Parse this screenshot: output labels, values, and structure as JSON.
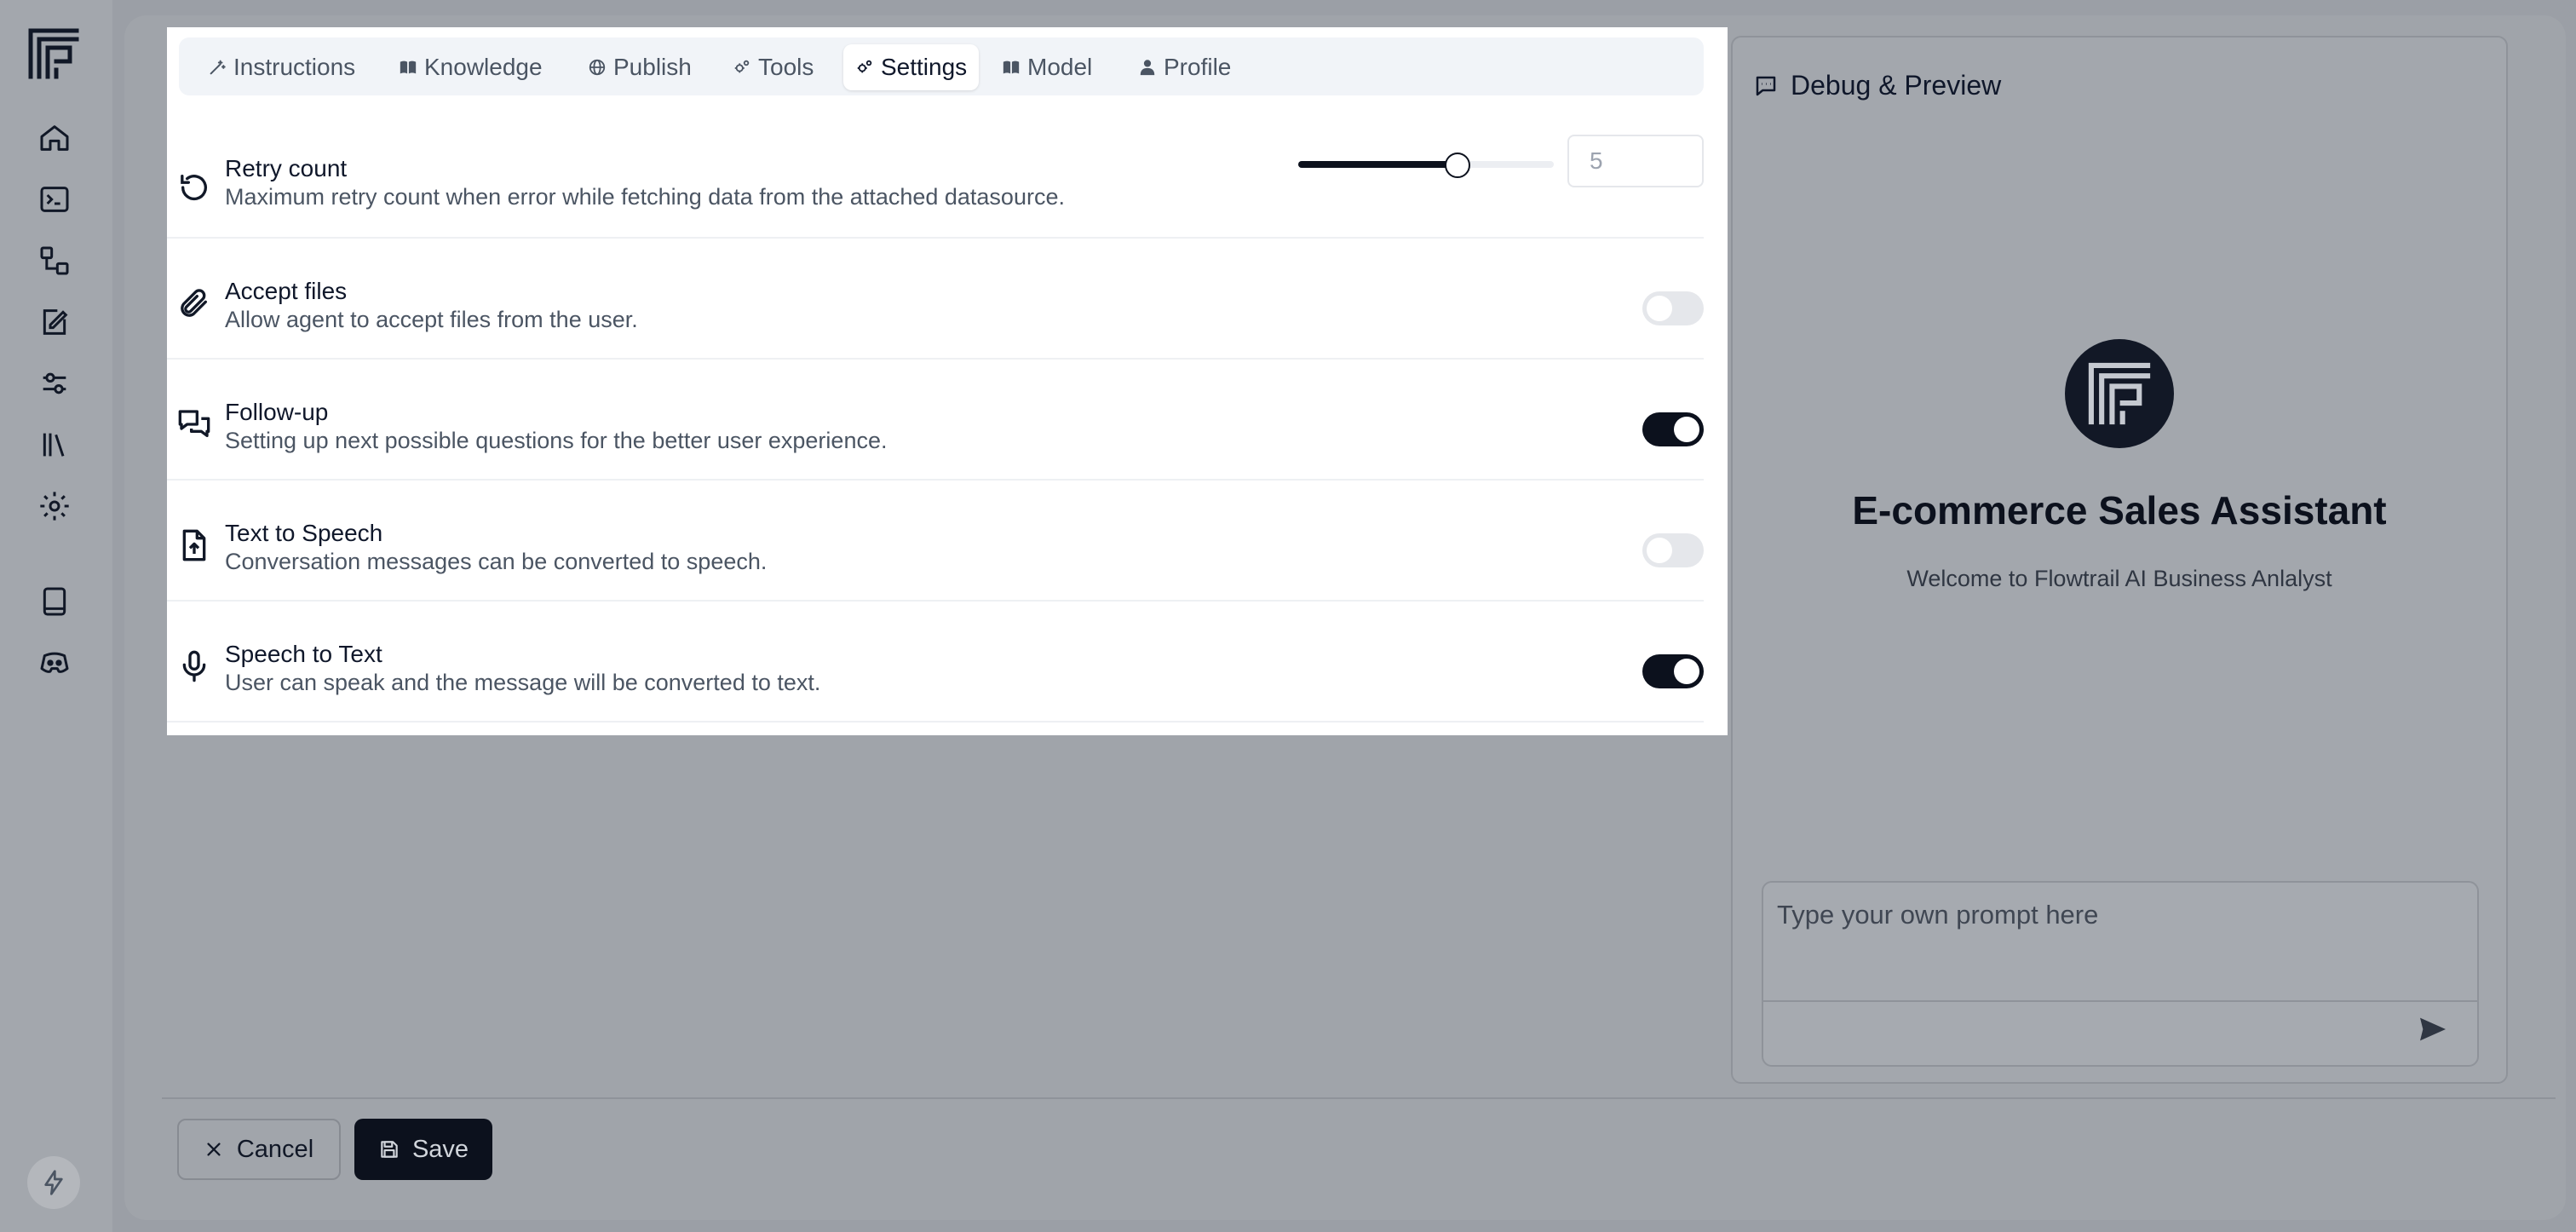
{
  "app": {
    "sidebar": {
      "items": [
        {
          "icon": "home-icon"
        },
        {
          "icon": "terminal-icon"
        },
        {
          "icon": "workflow-icon"
        },
        {
          "icon": "document-edit-icon"
        },
        {
          "icon": "sliders-icon"
        },
        {
          "icon": "library-icon"
        },
        {
          "icon": "gear-icon"
        },
        {
          "icon": "book-icon"
        },
        {
          "icon": "discord-icon"
        }
      ],
      "bottom_icon": "bolt-icon"
    }
  },
  "tabs": [
    {
      "label": "Instructions",
      "icon": "wand-icon",
      "active": false
    },
    {
      "label": "Knowledge",
      "icon": "book-open-icon",
      "active": false
    },
    {
      "label": "Publish",
      "icon": "globe-icon",
      "active": false
    },
    {
      "label": "Tools",
      "icon": "cogs-icon",
      "active": false
    },
    {
      "label": "Settings",
      "icon": "cogs-icon",
      "active": true
    },
    {
      "label": "Model",
      "icon": "book-open-icon",
      "active": false
    },
    {
      "label": "Profile",
      "icon": "user-icon",
      "active": false
    }
  ],
  "settings": {
    "retry": {
      "title": "Retry count",
      "description": "Maximum retry count when error while fetching data from the attached datasource.",
      "value": "5",
      "slider_fraction": 0.62
    },
    "accept_files": {
      "title": "Accept files",
      "description": "Allow agent to accept files from the user.",
      "enabled": false
    },
    "follow_up": {
      "title": "Follow-up",
      "description": "Setting up next possible questions for the better user experience.",
      "enabled": true
    },
    "tts": {
      "title": "Text to Speech",
      "description": "Conversation messages can be converted to speech.",
      "enabled": false
    },
    "stt": {
      "title": "Speech to Text",
      "description": "User can speak and the message will be converted to text.",
      "enabled": true
    }
  },
  "footer": {
    "cancel_label": "Cancel",
    "save_label": "Save"
  },
  "preview": {
    "header": "Debug & Preview",
    "title": "E-commerce Sales Assistant",
    "subtitle": "Welcome to Flowtrail AI Business Anlalyst",
    "prompt_placeholder": "Type your own prompt here"
  },
  "colors": {
    "accent": "#0c111d",
    "overlay": "#9b9fa6",
    "toggle_off": "#e5e7eb"
  }
}
